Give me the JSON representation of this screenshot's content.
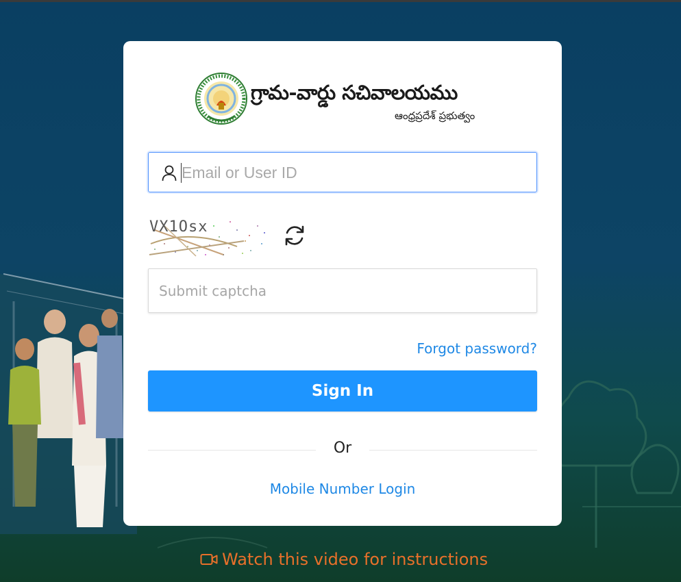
{
  "colors": {
    "accent": "#1e95ff",
    "link": "#1e88e5",
    "video_link": "#e8702a",
    "background_top": "#0a3f62",
    "background_bottom": "#0f3d2a"
  },
  "brand": {
    "title": "గ్రామ-వార్డు సచివాలయము",
    "subtitle": "ఆంధ్రప్రదేశ్ ప్రభుత్వం",
    "emblem_icon": "andhra-pradesh-emblem"
  },
  "login": {
    "email_placeholder": "Email or User ID",
    "email_value": "",
    "user_icon": "user-icon",
    "captcha_text": "VX1Osx",
    "refresh_icon": "refresh-icon",
    "captcha_placeholder": "Submit captcha",
    "captcha_value": "",
    "forgot_label": "Forgot password?",
    "signin_label": "Sign In",
    "or_label": "Or",
    "mobile_login_label": "Mobile Number Login"
  },
  "footer": {
    "video_label": "Watch this video for instructions",
    "video_icon": "video-camera-icon"
  }
}
